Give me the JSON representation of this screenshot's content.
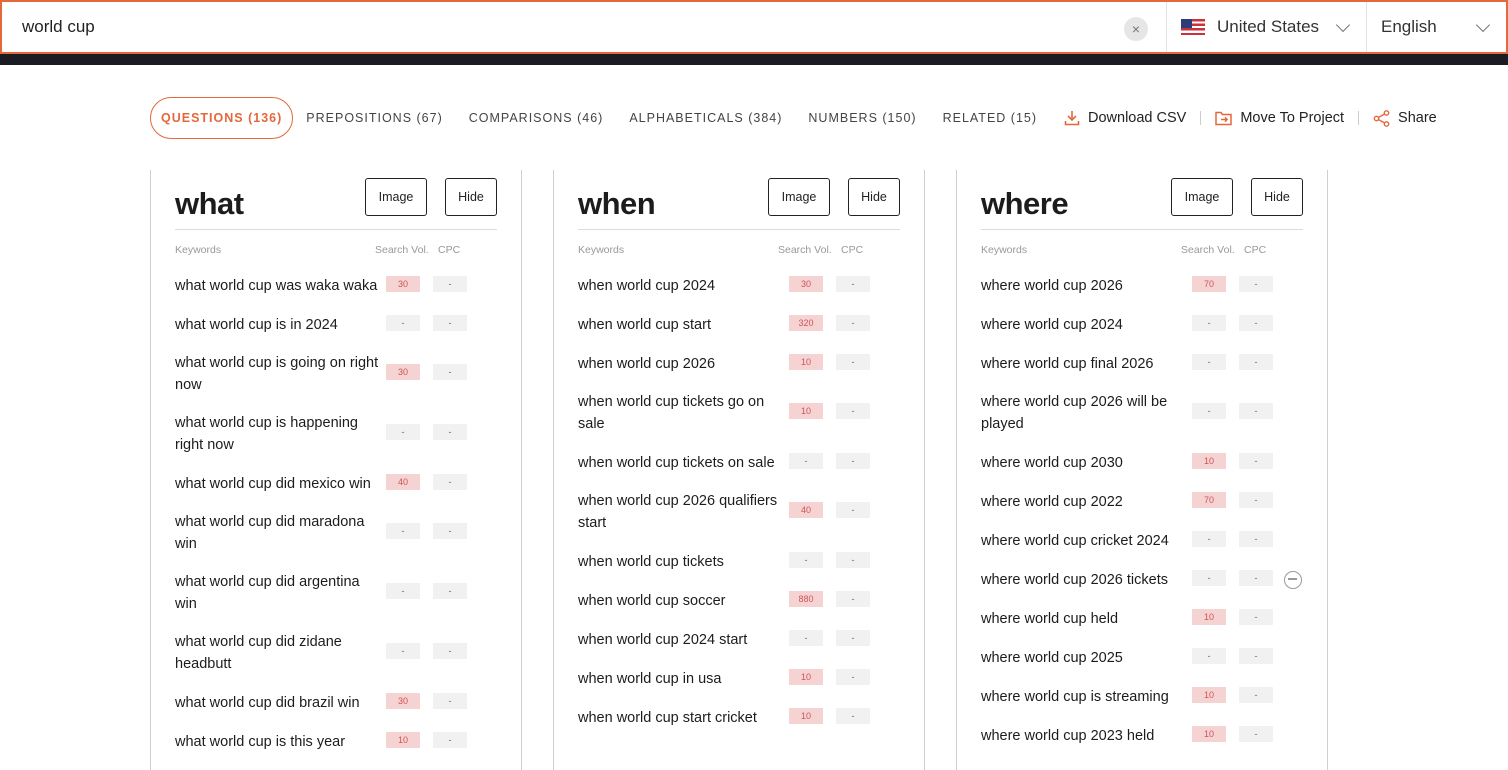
{
  "search": {
    "query": "world cup",
    "clear_symbol": "×"
  },
  "country": {
    "value": "United States"
  },
  "language": {
    "value": "English"
  },
  "tabs": [
    {
      "label": "QUESTIONS (136)",
      "active": true
    },
    {
      "label": "PREPOSITIONS (67)"
    },
    {
      "label": "COMPARISONS (46)"
    },
    {
      "label": "ALPHABETICALS (384)"
    },
    {
      "label": "NUMBERS (150)"
    },
    {
      "label": "RELATED (15)"
    }
  ],
  "actions": {
    "download": "Download CSV",
    "move": "Move To Project",
    "share": "Share"
  },
  "colors": {
    "accent": "#e4683b",
    "volume_high_bg": "#f6d3d3",
    "dark_band": "#1b1b24"
  },
  "card_labels": {
    "image": "Image",
    "hide": "Hide",
    "keywords": "Keywords",
    "search_vol": "Search Vol.",
    "cpc": "CPC"
  },
  "cards": [
    {
      "title": "what",
      "rows": [
        {
          "kw": "what world cup was waka waka",
          "vol": "30",
          "cpc": "-"
        },
        {
          "kw": "what world cup is in 2024",
          "vol": "-",
          "cpc": "-"
        },
        {
          "kw": "what world cup is going on right now",
          "vol": "30",
          "cpc": "-"
        },
        {
          "kw": "what world cup is happening right now",
          "vol": "-",
          "cpc": "-"
        },
        {
          "kw": "what world cup did mexico win",
          "vol": "40",
          "cpc": "-"
        },
        {
          "kw": "what world cup did maradona win",
          "vol": "-",
          "cpc": "-"
        },
        {
          "kw": "what world cup did argentina win",
          "vol": "-",
          "cpc": "-"
        },
        {
          "kw": "what world cup did zidane headbutt",
          "vol": "-",
          "cpc": "-"
        },
        {
          "kw": "what world cup did brazil win",
          "vol": "30",
          "cpc": "-"
        },
        {
          "kw": "what world cup is this year",
          "vol": "10",
          "cpc": "-"
        }
      ]
    },
    {
      "title": "when",
      "rows": [
        {
          "kw": "when world cup 2024",
          "vol": "30",
          "cpc": "-"
        },
        {
          "kw": "when world cup start",
          "vol": "320",
          "cpc": "-"
        },
        {
          "kw": "when world cup 2026",
          "vol": "10",
          "cpc": "-"
        },
        {
          "kw": "when world cup tickets go on sale",
          "vol": "10",
          "cpc": "-"
        },
        {
          "kw": "when world cup tickets on sale",
          "vol": "-",
          "cpc": "-"
        },
        {
          "kw": "when world cup 2026 qualifiers start",
          "vol": "40",
          "cpc": "-"
        },
        {
          "kw": "when world cup tickets",
          "vol": "-",
          "cpc": "-"
        },
        {
          "kw": "when world cup soccer",
          "vol": "880",
          "cpc": "-"
        },
        {
          "kw": "when world cup 2024 start",
          "vol": "-",
          "cpc": "-"
        },
        {
          "kw": "when world cup in usa",
          "vol": "10",
          "cpc": "-"
        },
        {
          "kw": "when world cup start cricket",
          "vol": "10",
          "cpc": "-"
        }
      ]
    },
    {
      "title": "where",
      "rows": [
        {
          "kw": "where world cup 2026",
          "vol": "70",
          "cpc": "-"
        },
        {
          "kw": "where world cup 2024",
          "vol": "-",
          "cpc": "-"
        },
        {
          "kw": "where world cup final 2026",
          "vol": "-",
          "cpc": "-"
        },
        {
          "kw": "where world cup 2026 will be played",
          "vol": "-",
          "cpc": "-"
        },
        {
          "kw": "where world cup 2030",
          "vol": "10",
          "cpc": "-"
        },
        {
          "kw": "where world cup 2022",
          "vol": "70",
          "cpc": "-"
        },
        {
          "kw": "where world cup cricket 2024",
          "vol": "-",
          "cpc": "-"
        },
        {
          "kw": "where world cup 2026 tickets",
          "vol": "-",
          "cpc": "-",
          "hovered": true
        },
        {
          "kw": "where world cup held",
          "vol": "10",
          "cpc": "-"
        },
        {
          "kw": "where world cup 2025",
          "vol": "-",
          "cpc": "-"
        },
        {
          "kw": "where world cup is streaming",
          "vol": "10",
          "cpc": "-"
        },
        {
          "kw": "where world cup 2023 held",
          "vol": "10",
          "cpc": "-"
        }
      ]
    }
  ]
}
